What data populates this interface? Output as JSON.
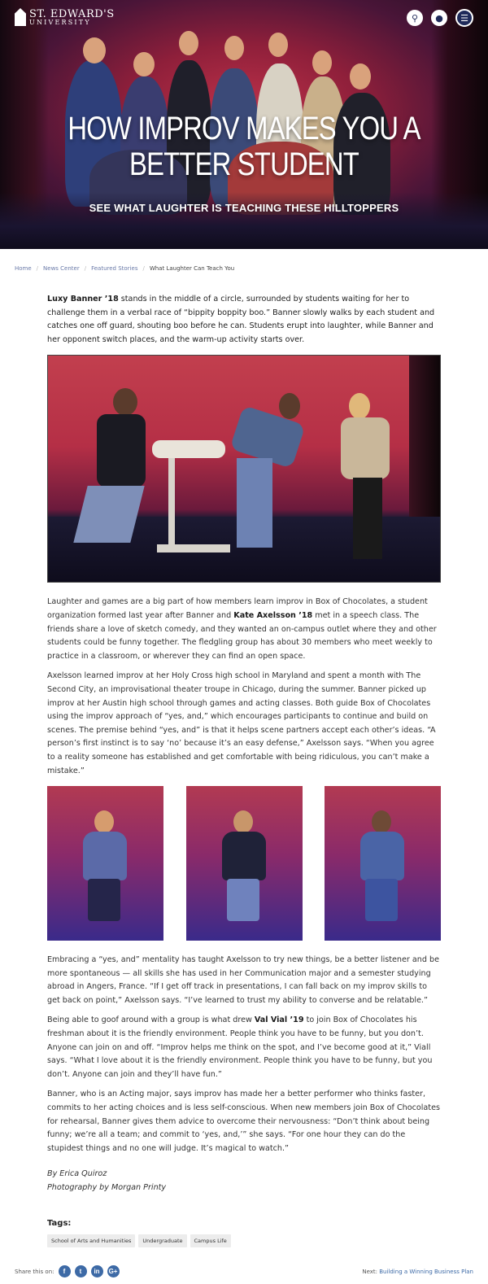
{
  "header": {
    "logo_line1": "ST. EDWARD'S",
    "logo_line2": "UNIVERSITY",
    "search_icon": "search-icon",
    "account_icon": "user-icon",
    "menu_icon": "menu-icon"
  },
  "hero": {
    "title": "HOW IMPROV MAKES YOU A BETTER STUDENT",
    "subtitle": "SEE WHAT LAUGHTER IS TEACHING THESE HILLTOPPERS"
  },
  "breadcrumb": {
    "items": [
      "Home",
      "News Center",
      "Featured Stories"
    ],
    "current": "What Laughter Can Teach You"
  },
  "article": {
    "p1_name": "Luxy Banner ’18",
    "p1_text": " stands in the middle of a circle, surrounded by students waiting for her to challenge them in a verbal race of “bippity boppity boo.” Banner slowly walks by each student and catches one off guard, shouting boo before he can. Students erupt into laughter, while Banner and her opponent switch places, and the warm-up activity starts over.",
    "p2_a": "Laughter and games are a big part of how members learn improv in Box of Chocolates, a student organization formed last year after Banner and ",
    "p2_name": "Kate Axelsson ’18",
    "p2_b": " met in a speech class. The friends share a love of sketch comedy, and they wanted an on-campus outlet where they and other students could be funny together. The fledgling group has about 30 members who meet weekly to practice in a classroom, or wherever they can find an open space.",
    "p3": "Axelsson learned improv at her Holy Cross high school in Maryland and spent a month with The Second City, an improvisational theater troupe in Chicago, during the summer. Banner picked up improv at her Austin high school through games and acting classes. Both guide Box of Chocolates using the improv approach of “yes, and,” which encourages participants to continue and build on scenes. The premise behind “yes, and” is that it helps scene partners accept each other’s ideas. “A person’s first instinct is to say ‘no’ because it’s an easy defense,” Axelsson says. “When you agree to a reality someone has established and get comfortable with being ridiculous, you can’t make a mistake.”",
    "p4": "Embracing a “yes, and” mentality has taught Axelsson to try new things, be a better listener and be more spontaneous — all skills she has used in her Communication major and a semester studying abroad in Angers, France. “If I get off track in presentations, I can fall back on my improv skills to get back on point,” Axelsson says. “I’ve learned to trust my ability to converse and be relatable.”",
    "p5_a": "Being able to goof around with a group is what drew ",
    "p5_name": "Val Vial ’19",
    "p5_b": " to join Box of Chocolates his freshman about it is the friendly environment. People think you have to be funny, but you don’t. Anyone can join on and off. “Improv helps me think on the spot, and I’ve become good at it,” Viall says. “What I love about it is the friendly environment. People think you have to be funny, but you don’t. Anyone can join and they’ll have fun.”",
    "p6": "Banner, who is an Acting major, says improv has made her a better performer who thinks faster, commits to her acting choices and is less self-conscious. When new members join Box of Chocolates for rehearsal, Banner gives them advice to overcome their nervousness: “Don’t think about being funny; we’re all a team; and commit to ‘yes, and,’” she says. “For one hour they can do the stupidest things and no one will judge. It’s magical to watch.”",
    "byline1": "By Erica Quiroz",
    "byline2": "Photography by Morgan Printy"
  },
  "tags": {
    "title": "Tags:",
    "items": [
      "School of Arts and Humanities",
      "Undergraduate",
      "Campus Life"
    ]
  },
  "footer": {
    "share_label": "Share this on:",
    "social": [
      "f",
      "t",
      "in",
      "G+"
    ],
    "next_label": "Next:",
    "next_link": "Building a Winning Business Plan"
  }
}
